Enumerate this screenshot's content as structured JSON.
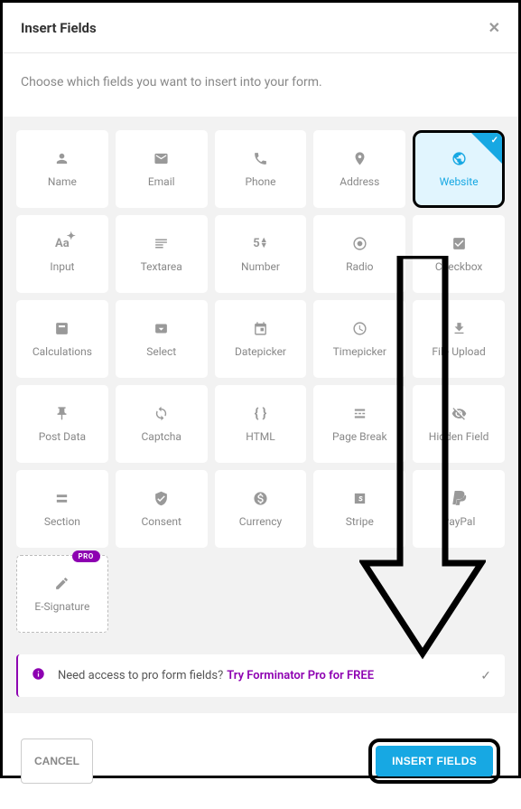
{
  "header": {
    "title": "Insert Fields"
  },
  "subtitle": "Choose which fields you want to insert into your form.",
  "fields": {
    "name": "Name",
    "email": "Email",
    "phone": "Phone",
    "address": "Address",
    "website": "Website",
    "input": "Input",
    "textarea": "Textarea",
    "number": "Number",
    "radio": "Radio",
    "checkbox": "Checkbox",
    "calculations": "Calculations",
    "select": "Select",
    "datepicker": "Datepicker",
    "timepicker": "Timepicker",
    "fileupload": "File Upload",
    "postdata": "Post Data",
    "captcha": "Captcha",
    "html": "HTML",
    "pagebreak": "Page Break",
    "hiddenfield": "Hidden Field",
    "section": "Section",
    "consent": "Consent",
    "currency": "Currency",
    "stripe": "Stripe",
    "paypal": "PayPal",
    "esignature": "E-Signature"
  },
  "pro_badge": "PRO",
  "notice": {
    "text": "Need access to pro form fields?",
    "link": "Try Forminator Pro for FREE"
  },
  "footer": {
    "cancel": "CANCEL",
    "insert": "INSERT FIELDS"
  }
}
